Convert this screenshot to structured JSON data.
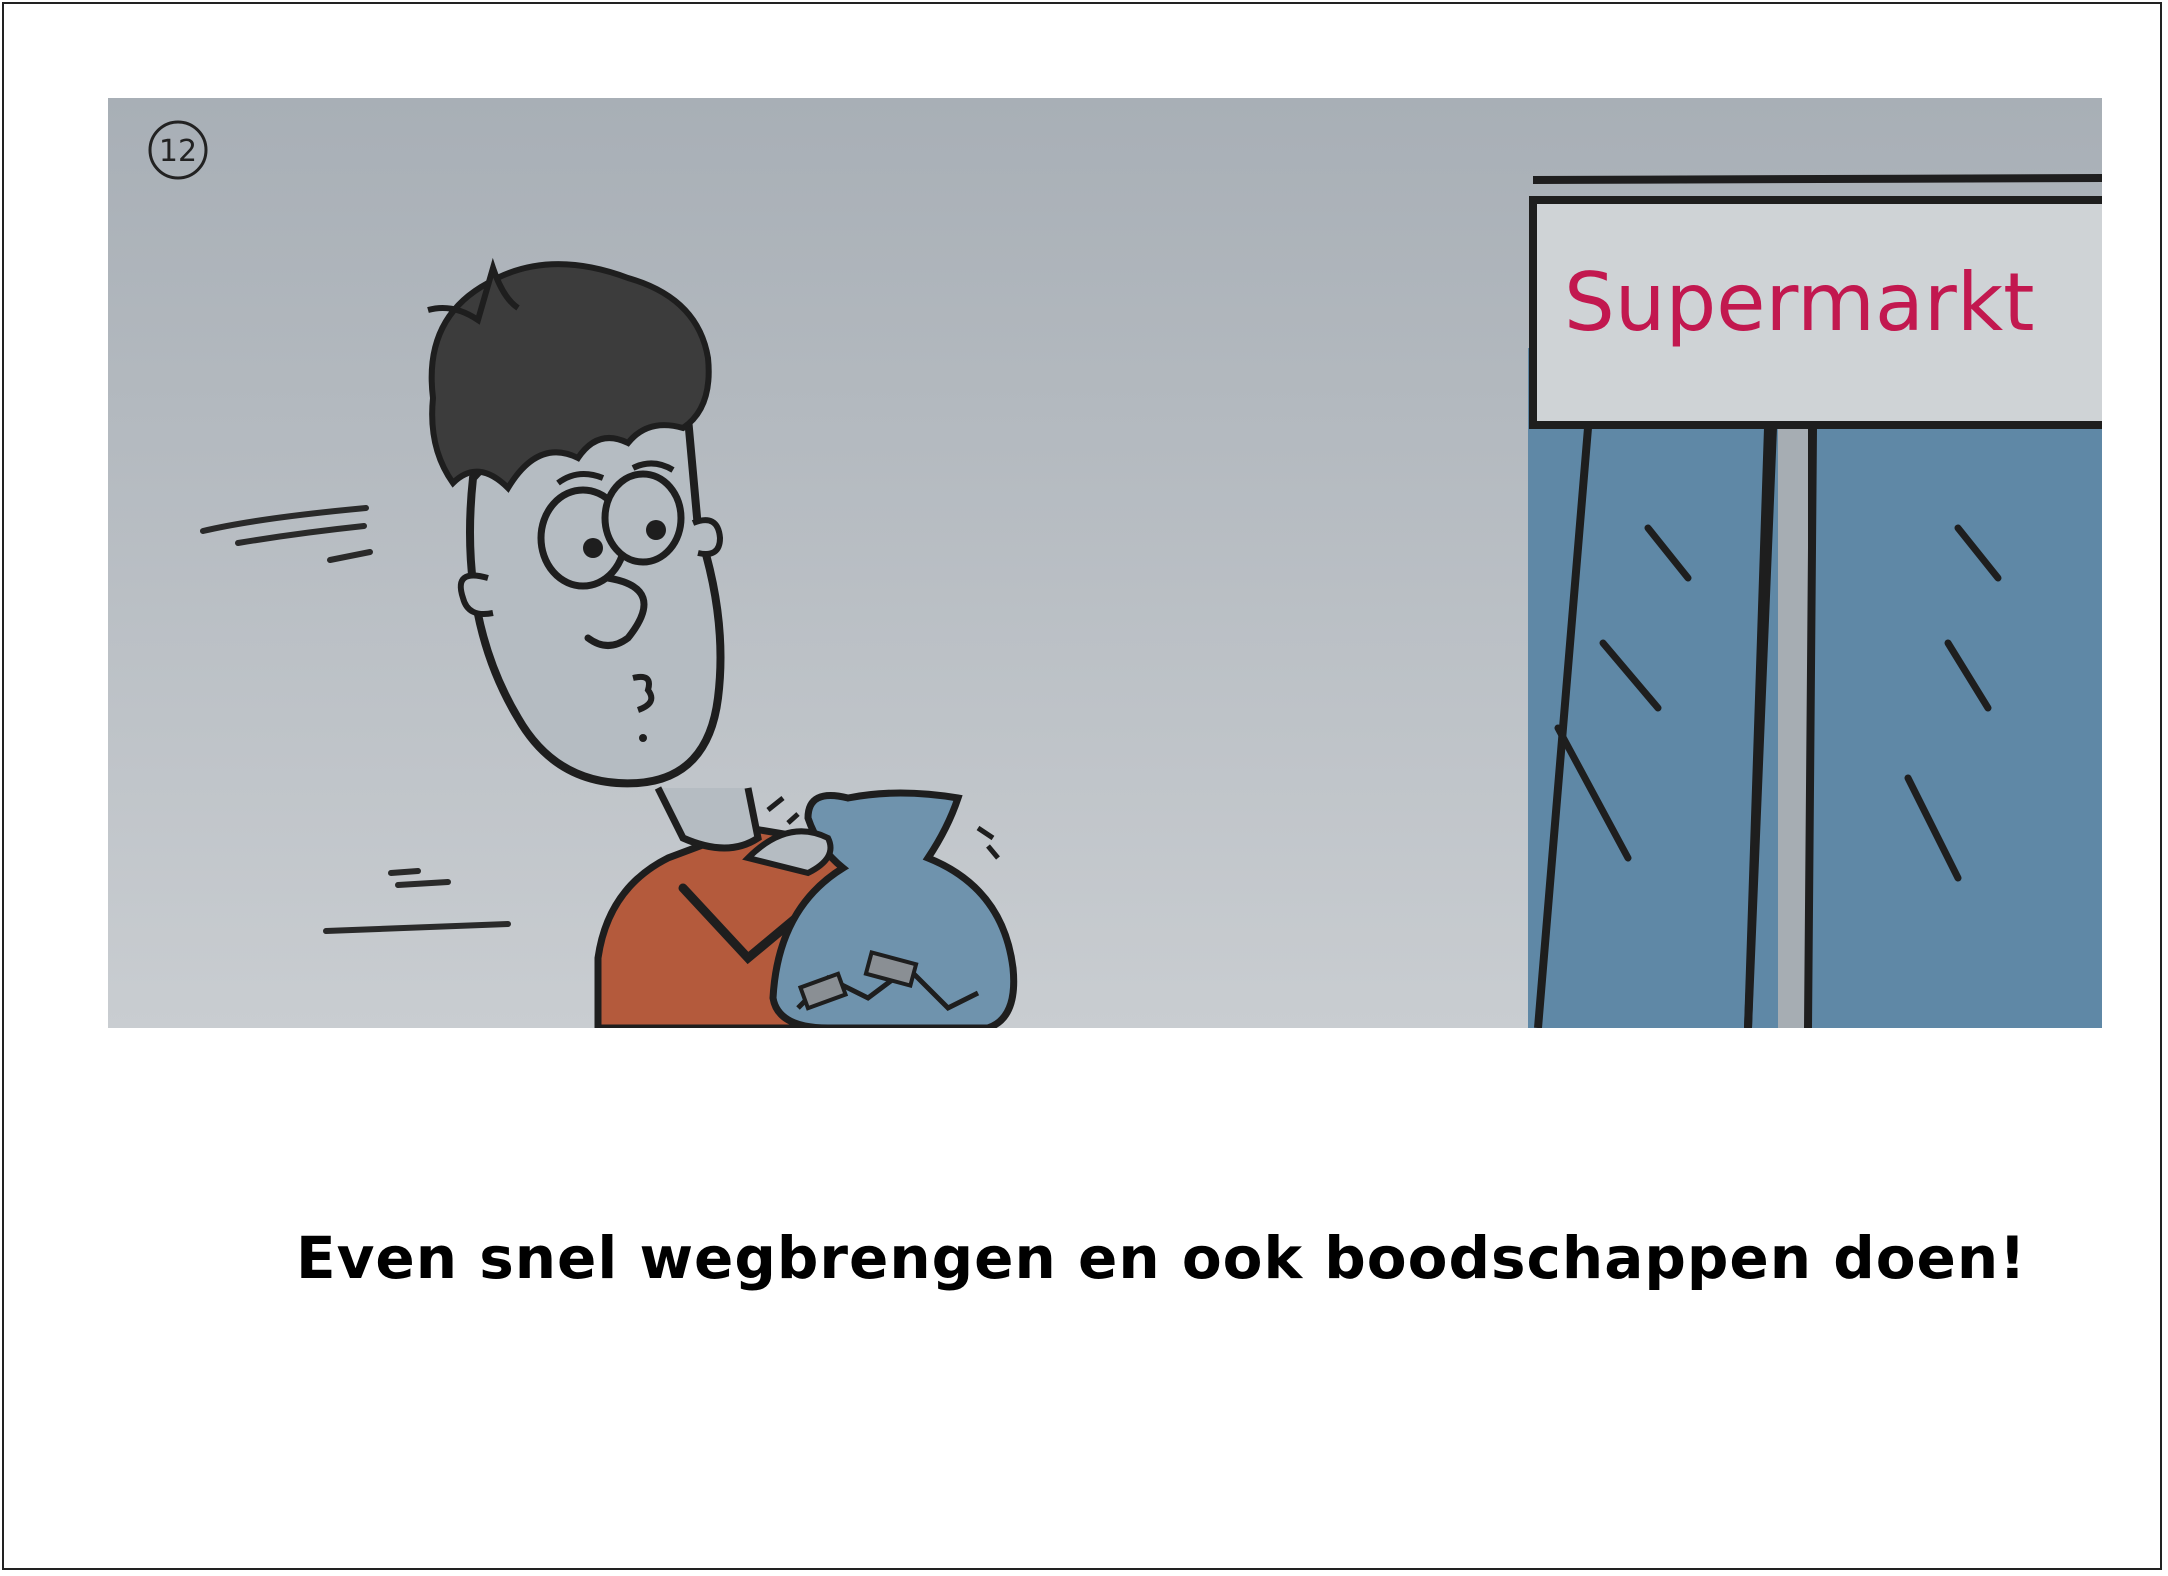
{
  "panel": {
    "number": "12",
    "sign_text": "Supermarkt"
  },
  "caption": "Even snel wegbrengen en ook boodschappen doen!",
  "colors": {
    "sky_top": "#a9b0b7",
    "sky_bottom": "#c8ccd0",
    "shirt": "#b45a3c",
    "bag": "#6f93ad",
    "glass": "#5f88a6",
    "sign_text": "#c2184f",
    "outline": "#1e1e1e"
  },
  "icons": [
    "running-boy-figure",
    "trash-bag-icon",
    "supermarket-building"
  ]
}
